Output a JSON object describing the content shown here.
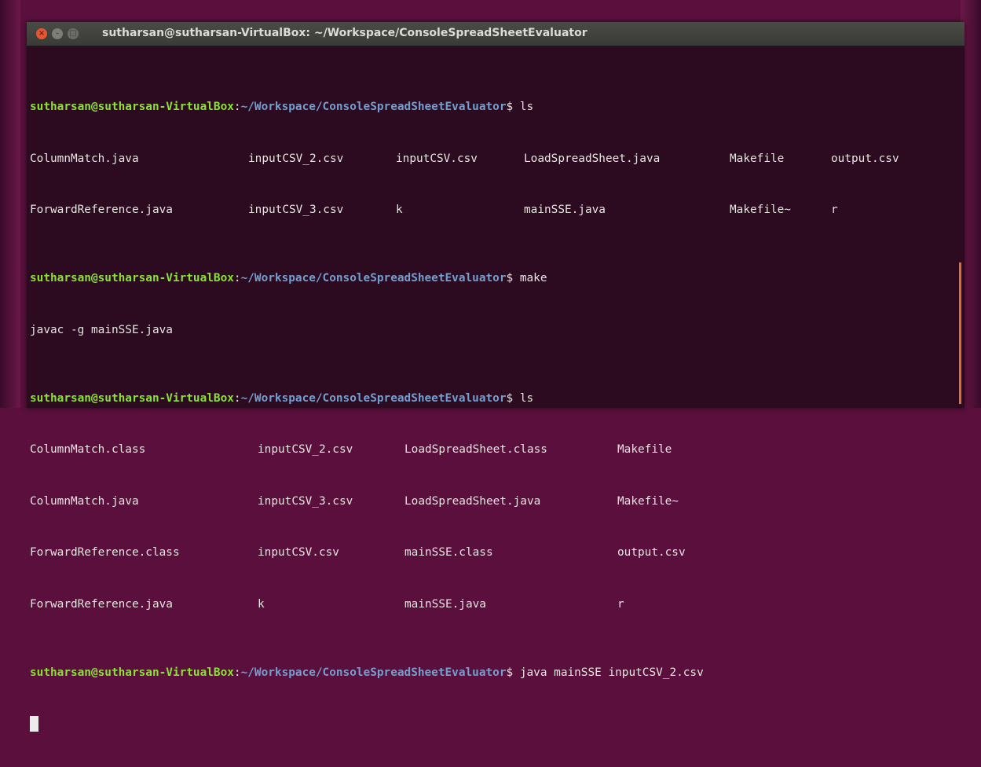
{
  "window": {
    "title": "sutharsan@sutharsan-VirtualBox: ~/Workspace/ConsoleSpreadSheetEvaluator",
    "buttons": {
      "close": "×",
      "minimize": "–",
      "maximize": "□"
    }
  },
  "prompt": {
    "user_host": "sutharsan@sutharsan-VirtualBox",
    "separator": ":",
    "path": "~/Workspace/ConsoleSpreadSheetEvaluator",
    "symbol": "$"
  },
  "session": [
    {
      "command": " ls",
      "rows": [
        [
          "ColumnMatch.java",
          "inputCSV_2.csv",
          "inputCSV.csv",
          "LoadSpreadSheet.java",
          "Makefile",
          "output.csv"
        ],
        [
          "ForwardReference.java",
          "inputCSV_3.csv",
          "k",
          "mainSSE.java",
          "Makefile~",
          "r"
        ]
      ]
    },
    {
      "command": " make",
      "output": [
        "javac -g mainSSE.java"
      ]
    },
    {
      "command": " ls",
      "rows": [
        [
          "ColumnMatch.class",
          "inputCSV_2.csv",
          "LoadSpreadSheet.class",
          "Makefile"
        ],
        [
          "ColumnMatch.java",
          "inputCSV_3.csv",
          "LoadSpreadSheet.java",
          "Makefile~"
        ],
        [
          "ForwardReference.class",
          "inputCSV.csv",
          "mainSSE.class",
          "output.csv"
        ],
        [
          "ForwardReference.java",
          "k",
          "mainSSE.java",
          "r"
        ]
      ]
    },
    {
      "command": " java mainSSE inputCSV_2.csv"
    }
  ],
  "colors": {
    "prompt_user": "#8ae234",
    "prompt_path": "#729fcf",
    "background": "#2c0a20",
    "text": "#e6e6e0"
  }
}
